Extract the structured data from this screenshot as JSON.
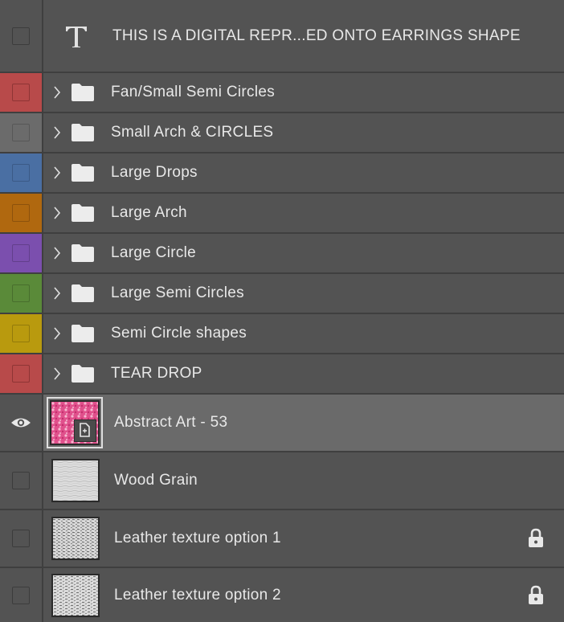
{
  "layers": [
    {
      "kind": "text",
      "name": "THIS IS A DIGITAL REPR...ED ONTO EARRINGS SHAPE",
      "color": "#535353",
      "visible": false
    },
    {
      "kind": "group",
      "name": "Fan/Small Semi Circles",
      "color": "#b84a4a",
      "visible": false
    },
    {
      "kind": "group",
      "name": "Small Arch & CIRCLES",
      "color": "#6b6b6b",
      "visible": false
    },
    {
      "kind": "group",
      "name": "Large Drops",
      "color": "#4a6fa3",
      "visible": false
    },
    {
      "kind": "group",
      "name": "Large Arch",
      "color": "#b0680f",
      "visible": false
    },
    {
      "kind": "group",
      "name": "Large Circle",
      "color": "#7b4fae",
      "visible": false
    },
    {
      "kind": "group",
      "name": "Large Semi Circles",
      "color": "#5a8a39",
      "visible": false
    },
    {
      "kind": "group",
      "name": "Semi Circle shapes",
      "color": "#b99a0e",
      "visible": false
    },
    {
      "kind": "group",
      "name": "TEAR DROP",
      "color": "#b84a4a",
      "visible": false
    },
    {
      "kind": "smart-object",
      "name": "Abstract Art - 53",
      "visible": true,
      "selected": true,
      "thumb": "pink-pattern"
    },
    {
      "kind": "pixel",
      "name": "Wood Grain",
      "visible": false,
      "thumb": "gray-grain"
    },
    {
      "kind": "pixel",
      "name": "Leather texture option 1",
      "visible": false,
      "locked": true,
      "thumb": "gray-noise"
    },
    {
      "kind": "pixel",
      "name": "Leather texture option 2",
      "visible": false,
      "locked": true,
      "thumb": "gray-noise"
    }
  ],
  "icons": {
    "eye": "eye-icon",
    "folder": "folder-icon",
    "chevron": "chevron-right-icon",
    "text": "text-layer-icon",
    "lock": "lock-icon"
  },
  "colors": {
    "panel": "#535353",
    "selected": "#6a6a6a",
    "divider": "#3f3f3f"
  }
}
